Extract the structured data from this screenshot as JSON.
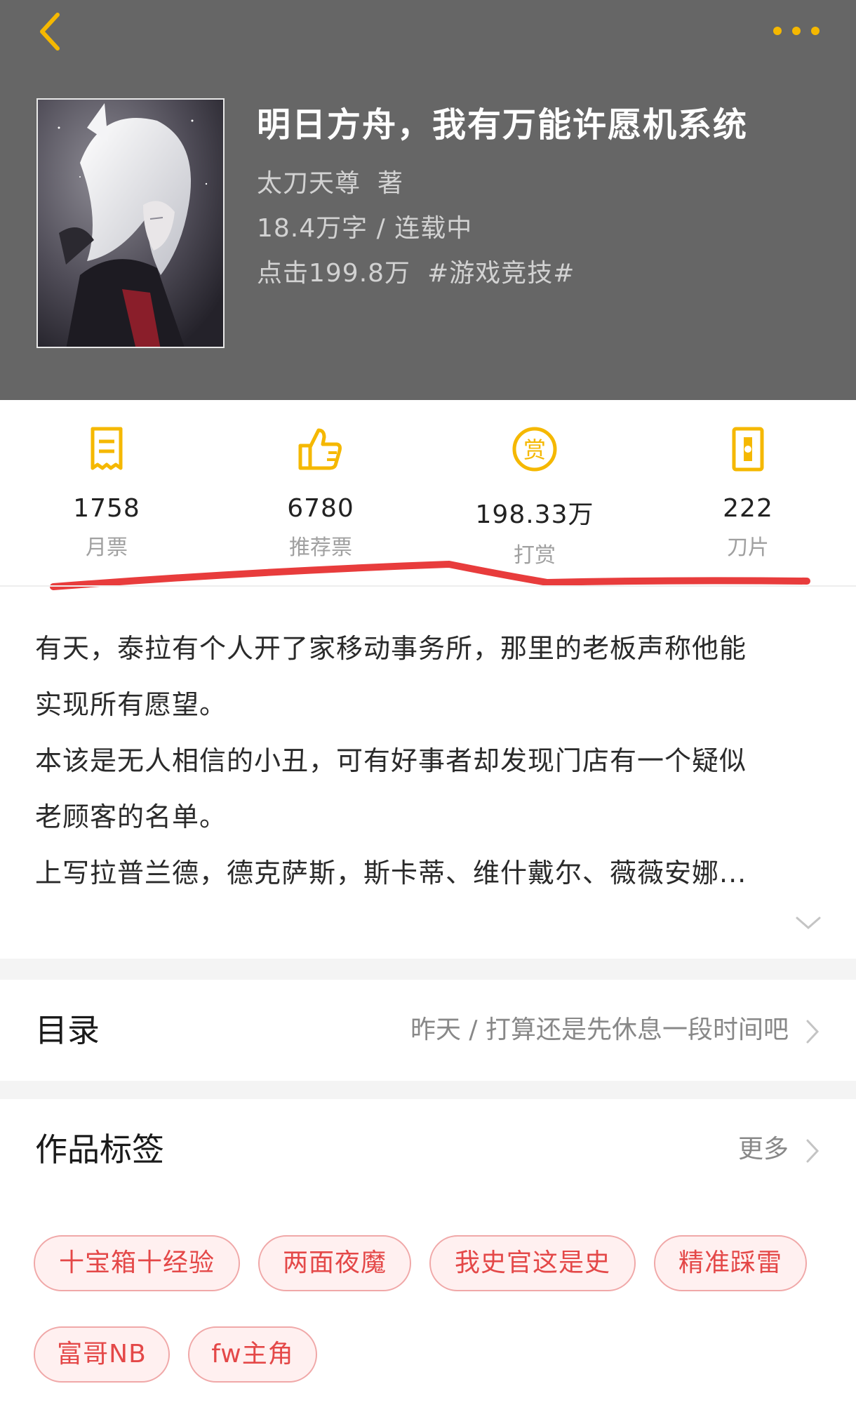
{
  "nav": {
    "back_icon": "chevron-left-icon",
    "more_icon": "more-dots-icon",
    "accent_color": "#f5b800"
  },
  "book": {
    "title": "明日方舟，我有万能许愿机系统",
    "author": "太刀天尊",
    "author_suffix": "著",
    "word_count": "18.4万字",
    "separator": "/",
    "status": "连载中",
    "clicks": "点击199.8万",
    "category": "#游戏竞技#"
  },
  "stats": [
    {
      "icon": "monthly-ticket-icon",
      "value": "1758",
      "label": "月票"
    },
    {
      "icon": "thumbs-up-icon",
      "value": "6780",
      "label": "推荐票"
    },
    {
      "icon": "reward-coin-icon",
      "value": "198.33万",
      "label": "打赏"
    },
    {
      "icon": "blade-icon",
      "value": "222",
      "label": "刀片"
    }
  ],
  "description": {
    "lines": [
      "有天，泰拉有个人开了家移动事务所，那里的老板声称他能",
      "实现所有愿望。",
      "本该是无人相信的小丑，可有好事者却发现门店有一个疑似",
      "老顾客的名单。",
      "上写拉普兰德，德克萨斯，斯卡蒂、维什戴尔、薇薇安娜..."
    ],
    "expand_icon": "chevron-down-icon"
  },
  "toc": {
    "title": "目录",
    "latest": "昨天 / 打算还是先休息一段时间吧"
  },
  "tags_section": {
    "title": "作品标签",
    "more": "更多",
    "tags": [
      "十宝箱十经验",
      "两面夜魔",
      "我史官这是史",
      "精准踩雷",
      "富哥NB",
      "fw主角"
    ]
  },
  "colors": {
    "header_bg": "#666666",
    "tag_text": "#e44848",
    "tag_border": "#f0a8a8",
    "annotation_red": "#e83c3c"
  }
}
